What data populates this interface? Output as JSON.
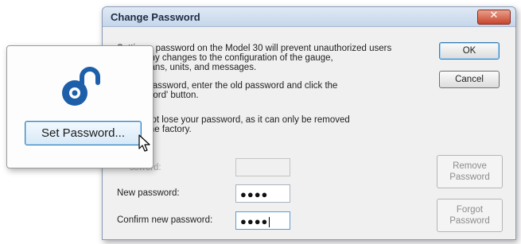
{
  "dialog": {
    "title": "Change Password",
    "close_glyph": "✕",
    "message_lines": [
      "Setting a password on the Model 30 will prevent unauthorized users",
      "      ng any changes to the configuration of the gauge,",
      "      erspans, units, and messages.",
      "      the password, enter the old password and click the",
      "      assword' button.",
      "      Do not lose your password, as it can only be removed",
      "      ing the factory."
    ],
    "ok_label": "OK",
    "cancel_label": "Cancel",
    "remove_label_1": "Remove",
    "remove_label_2": "Password",
    "forgot_label_1": "Forgot",
    "forgot_label_2": "Password",
    "old_password_label": "     ssword:",
    "new_password_label": "New password:",
    "confirm_password_label": "Confirm new password:",
    "new_password_value": "●●●●",
    "confirm_password_value": "●●●●"
  },
  "zoom": {
    "set_password_label": "Set Password..."
  },
  "icons": {
    "lock": "unlocked-padlock-icon",
    "cursor": "mouse-pointer-icon"
  },
  "colors": {
    "accent": "#3c7fb1",
    "lock_blue": "#1d5fa8",
    "close_red": "#c8452e"
  }
}
